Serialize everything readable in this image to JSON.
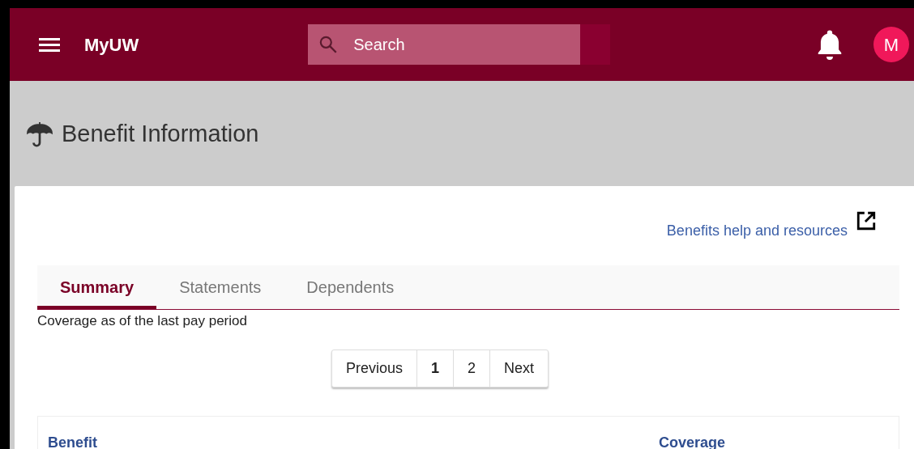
{
  "header": {
    "app_name": "MyUW",
    "search": {
      "placeholder": "Search"
    },
    "avatar": "M"
  },
  "page": {
    "title": "Benefit Information"
  },
  "help_link": "Benefits help and resources",
  "tabs": [
    {
      "label": "Summary",
      "selected": true
    },
    {
      "label": "Statements",
      "selected": false
    },
    {
      "label": "Dependents",
      "selected": false
    }
  ],
  "caption": "Coverage as of the last pay period",
  "pagination": {
    "previous": "Previous",
    "pages": [
      {
        "label": "1",
        "selected": true
      },
      {
        "label": "2",
        "selected": false
      }
    ],
    "next": "Next"
  },
  "table": {
    "columns": [
      "Benefit",
      "Coverage"
    ]
  }
}
